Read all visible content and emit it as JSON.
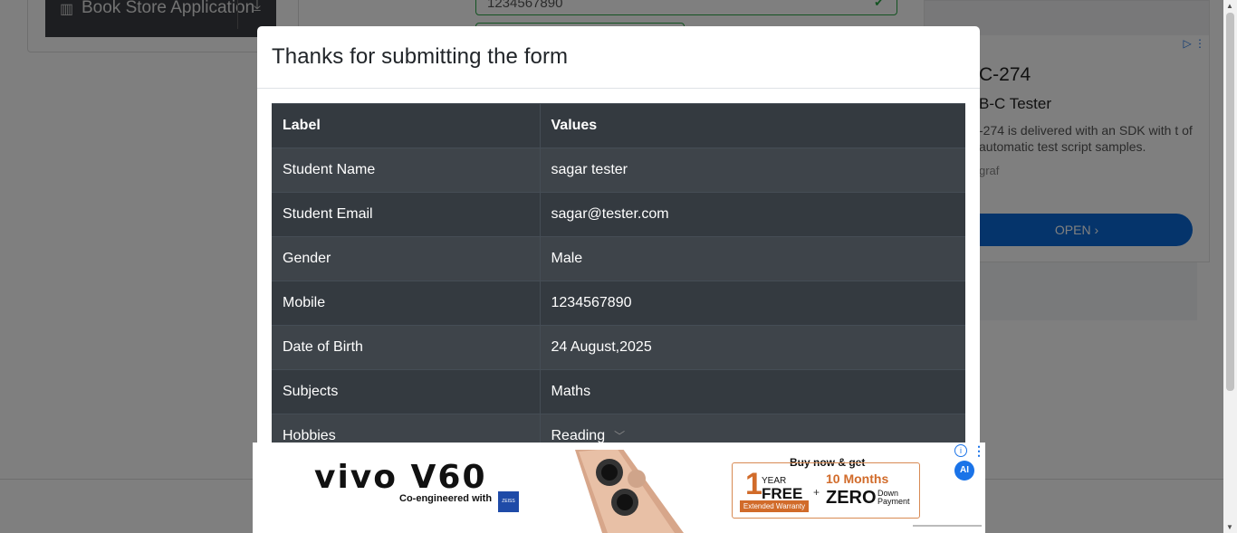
{
  "background": {
    "sidebar_item_label": "Book Store Application",
    "mobile_value": "1234567890",
    "ad": {
      "headline": "C-274",
      "subheadline": "B-C Tester",
      "description": "-274 is delivered with an SDK with t of automatic test script samples.",
      "advertiser": "graf",
      "open_label": "OPEN ›"
    }
  },
  "modal": {
    "title": "Thanks for submitting the form",
    "table": {
      "headers": [
        "Label",
        "Values"
      ],
      "rows": [
        {
          "label": "Student Name",
          "value": "sagar tester"
        },
        {
          "label": "Student Email",
          "value": "sagar@tester.com"
        },
        {
          "label": "Gender",
          "value": "Male"
        },
        {
          "label": "Mobile",
          "value": "1234567890"
        },
        {
          "label": "Date of Birth",
          "value": "24 August,2025"
        },
        {
          "label": "Subjects",
          "value": "Maths"
        },
        {
          "label": "Hobbies",
          "value": "Reading"
        }
      ]
    }
  },
  "bottom_ad": {
    "brand": "vivo V60",
    "tagline": "Co-engineered with",
    "partner": "ZEISS",
    "buy_now": "Buy now & get",
    "one": "1",
    "year": "YEAR",
    "free": "FREE",
    "extended": "Extended Warranty",
    "plus": "+",
    "months": "10 Months",
    "zero": "ZERO",
    "down_payment": "Down Payment",
    "ai_badge": "AI"
  },
  "colors": {
    "table_dark": "#343a40",
    "table_stripe": "#3e444a",
    "success_green": "#28a745",
    "ad_blue": "#0b69d6",
    "vivo_orange": "#d16b2a"
  }
}
